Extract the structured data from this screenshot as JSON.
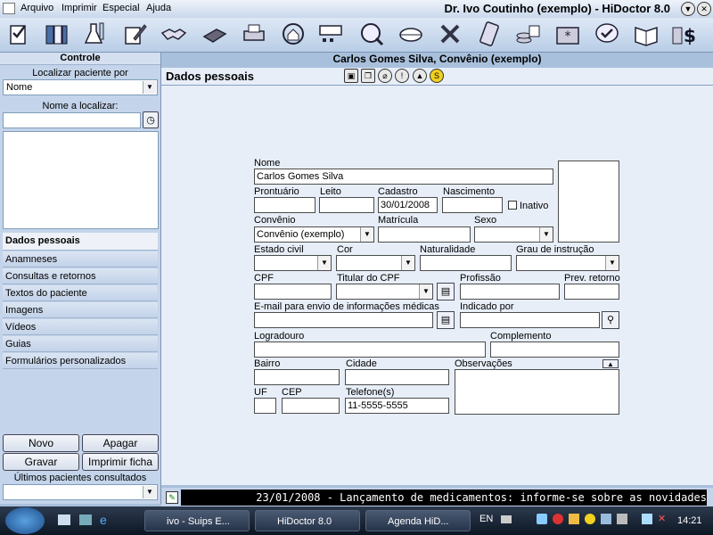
{
  "menu": {
    "items": [
      "Arquivo",
      "Imprimir",
      "Especial",
      "Ajuda"
    ],
    "app_title": "Dr. Ivo Coutinho (exemplo) - HiDoctor 8.0"
  },
  "left": {
    "title": "Controle",
    "localizar_label": "Localizar paciente por",
    "localizar_value": "Nome",
    "nome_label": "Nome a localizar:",
    "nome_value": "",
    "nav": [
      "Dados pessoais",
      "Anamneses",
      "Consultas e retornos",
      "Textos do paciente",
      "Imagens",
      "Vídeos",
      "Guias",
      "Formulários personalizados"
    ],
    "buttons": {
      "novo": "Novo",
      "apagar": "Apagar",
      "gravar": "Gravar",
      "imprimir": "Imprimir ficha"
    },
    "ultimos_label": "Últimos pacientes consultados",
    "ultimos_value": ""
  },
  "patient": {
    "header": "Carlos Gomes Silva, Convênio (exemplo)",
    "section_title": "Dados pessoais"
  },
  "form": {
    "nome_label": "Nome",
    "nome": "Carlos Gomes Silva",
    "prontuario_label": "Prontuário",
    "prontuario": "",
    "leito_label": "Leito",
    "leito": "",
    "cadastro_label": "Cadastro",
    "cadastro": "30/01/2008",
    "nascimento_label": "Nascimento",
    "nascimento": "",
    "inativo_label": "Inativo",
    "convenio_label": "Convênio",
    "convenio": "Convênio (exemplo)",
    "matricula_label": "Matrícula",
    "matricula": "",
    "sexo_label": "Sexo",
    "sexo": "",
    "estado_civil_label": "Estado civil",
    "estado_civil": "",
    "cor_label": "Cor",
    "cor": "",
    "naturalidade_label": "Naturalidade",
    "naturalidade": "",
    "grau_label": "Grau de instrução",
    "grau": "",
    "cpf_label": "CPF",
    "cpf": "",
    "titular_label": "Titular do CPF",
    "titular": "",
    "profissao_label": "Profissão",
    "profissao": "",
    "prev_retorno_label": "Prev. retorno",
    "prev_retorno": "",
    "email_label": "E-mail para envio de informações médicas",
    "email": "",
    "indicado_label": "Indicado por",
    "indicado": "",
    "logradouro_label": "Logradouro",
    "logradouro": "",
    "complemento_label": "Complemento",
    "complemento": "",
    "bairro_label": "Bairro",
    "bairro": "",
    "cidade_label": "Cidade",
    "cidade": "",
    "observacoes_label": "Observações",
    "observacoes": "",
    "uf_label": "UF",
    "uf": "",
    "cep_label": "CEP",
    "cep": "",
    "telefone_label": "Telefone(s)",
    "telefone": "11-5555-5555"
  },
  "ticker": "23/01/2008 - Lançamento de medicamentos: informe-se sobre as novidades",
  "taskbar": {
    "tasks": [
      "ivo - Suips E...",
      "HiDoctor 8.0",
      "Agenda HiD..."
    ],
    "lang": "EN",
    "clock": "14:21"
  },
  "colors": {
    "accent": "#a9c0dc",
    "panel": "#c4d4ea",
    "form_bg": "#e7eef8"
  }
}
